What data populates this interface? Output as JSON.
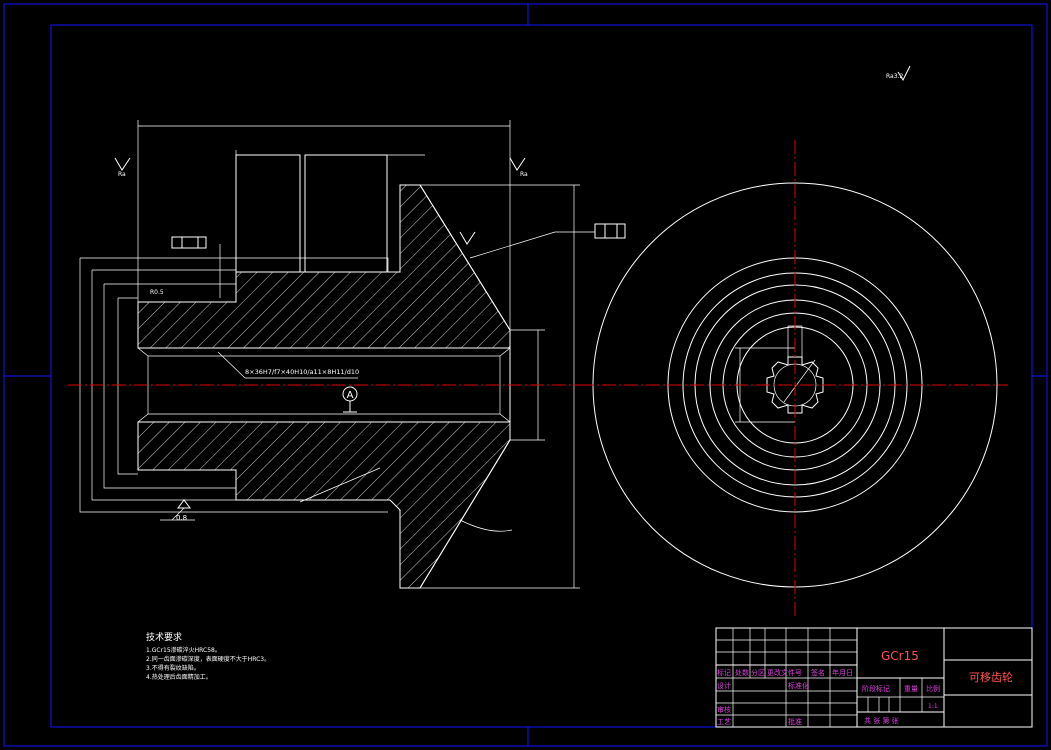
{
  "drawing": {
    "material": "GCr15",
    "part_name": "可移齿轮",
    "surface_finish": "Ra3.2",
    "datum": "A",
    "spline_callout": "8×36H7/f7×40H10/a11×8H11/d10",
    "tolerance_box_value": "0.8",
    "tech_requirements_title": "技术要求",
    "tech_requirements": [
      "1.GCr15渗碳淬火HRC58。",
      "2.同一齿面渗碳深度，表面硬度不大于HRC3。",
      "3.不得有裂纹缺陷。",
      "4.热处理后齿面精加工。"
    ],
    "title_block": {
      "row_labels": [
        "标记",
        "处数",
        "分区",
        "更改文件号",
        "签名",
        "年月日"
      ],
      "design": "设计",
      "standardization": "标准化",
      "stage_mark": "阶段标记",
      "weight": "重量",
      "scale": "比例",
      "scale_value": "1:1",
      "review": "审核",
      "process": "工艺",
      "approve": "批准",
      "sheets": "共  张 第  张"
    }
  }
}
